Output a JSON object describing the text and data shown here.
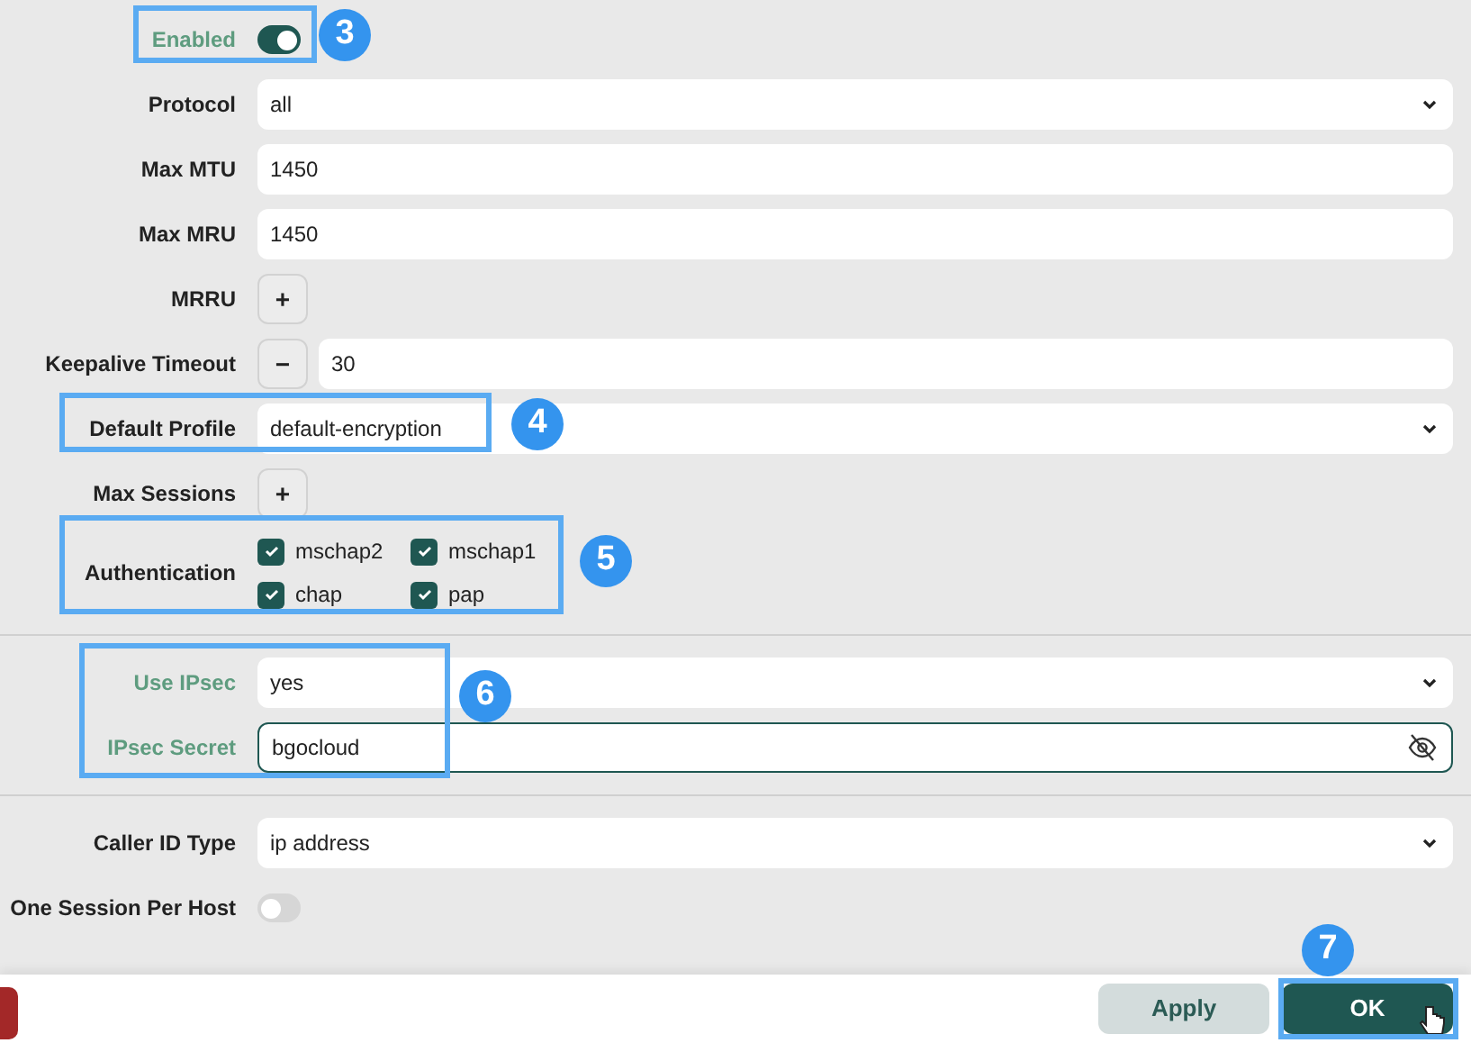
{
  "rows": [
    {
      "kind": "toggle",
      "label": "Enabled",
      "on": true,
      "accent": true,
      "callout": "3"
    },
    {
      "kind": "select",
      "label": "Protocol",
      "value": "all"
    },
    {
      "kind": "text",
      "label": "Max MTU",
      "value": "1450"
    },
    {
      "kind": "text",
      "label": "Max MRU",
      "value": "1450"
    },
    {
      "kind": "add",
      "label": "MRRU",
      "symbol": "+"
    },
    {
      "kind": "number",
      "label": "Keepalive Timeout",
      "symbol": "−",
      "value": "30"
    },
    {
      "kind": "select",
      "label": "Default Profile",
      "value": "default-encryption",
      "callout": "4"
    },
    {
      "kind": "add",
      "label": "Max Sessions",
      "symbol": "+"
    },
    {
      "kind": "checks",
      "label": "Authentication",
      "callout": "5",
      "options": [
        {
          "label": "mschap2",
          "checked": true
        },
        {
          "label": "mschap1",
          "checked": true
        },
        {
          "label": "chap",
          "checked": true
        },
        {
          "label": "pap",
          "checked": true
        }
      ]
    },
    {
      "kind": "divider"
    },
    {
      "kind": "select",
      "label": "Use IPsec",
      "value": "yes",
      "accent": true,
      "callout": "6"
    },
    {
      "kind": "password",
      "label": "IPsec Secret",
      "value": "bgocloud",
      "accent": true
    },
    {
      "kind": "divider"
    },
    {
      "kind": "select",
      "label": "Caller ID Type",
      "value": "ip address"
    },
    {
      "kind": "toggle",
      "label": "One Session Per Host",
      "on": false
    }
  ],
  "footer": {
    "apply": "Apply",
    "ok": "OK",
    "callout": "7"
  }
}
